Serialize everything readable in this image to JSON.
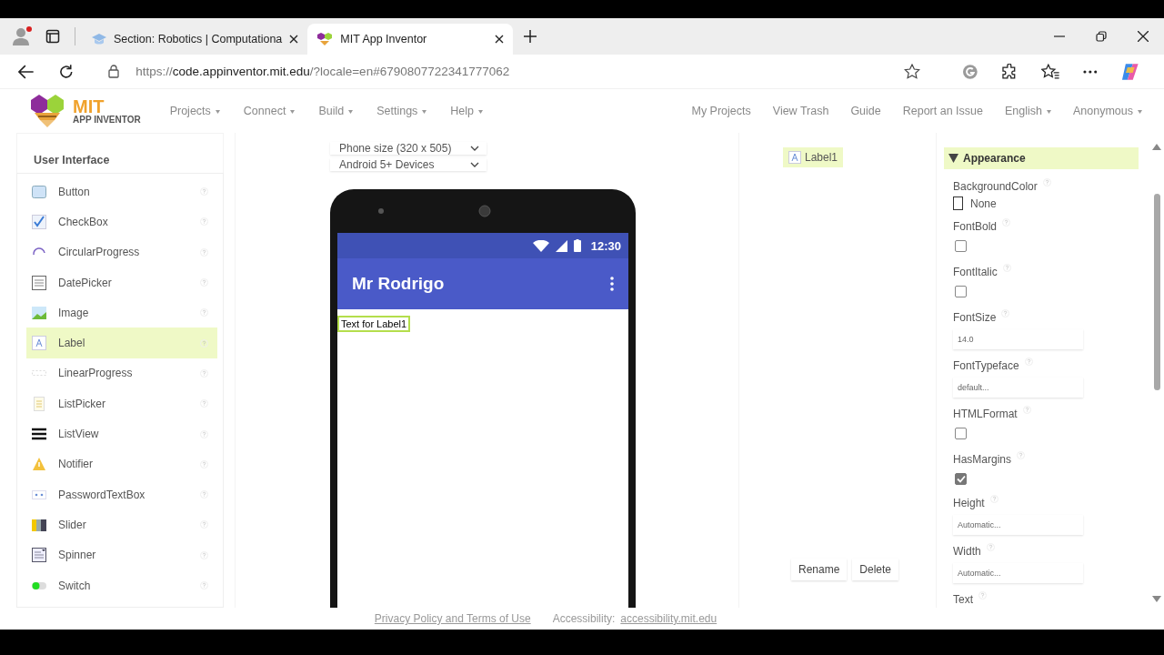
{
  "browser": {
    "tabs": [
      {
        "title": "Section: Robotics | Computationa",
        "selected": false
      },
      {
        "title": "MIT App Inventor",
        "selected": true
      }
    ],
    "url": {
      "scheme": "https://",
      "host": "code.appinventor.mit.edu",
      "path": "/?locale=en#6790807722341777062"
    }
  },
  "header": {
    "logo_title": "MIT",
    "logo_subtitle": "APP INVENTOR",
    "menus": [
      {
        "label": "Projects",
        "dropdown": true
      },
      {
        "label": "Connect",
        "dropdown": true
      },
      {
        "label": "Build",
        "dropdown": true
      },
      {
        "label": "Settings",
        "dropdown": true
      },
      {
        "label": "Help",
        "dropdown": true
      }
    ],
    "links": [
      {
        "label": "My Projects",
        "dropdown": false
      },
      {
        "label": "View Trash",
        "dropdown": false
      },
      {
        "label": "Guide",
        "dropdown": false
      },
      {
        "label": "Report an Issue",
        "dropdown": false
      },
      {
        "label": "English",
        "dropdown": true
      },
      {
        "label": "Anonymous",
        "dropdown": true
      }
    ]
  },
  "palette": {
    "title": "User Interface",
    "items": [
      {
        "name": "Button",
        "selected": false
      },
      {
        "name": "CheckBox",
        "selected": false
      },
      {
        "name": "CircularProgress",
        "selected": false
      },
      {
        "name": "DatePicker",
        "selected": false
      },
      {
        "name": "Image",
        "selected": false
      },
      {
        "name": "Label",
        "selected": true
      },
      {
        "name": "LinearProgress",
        "selected": false
      },
      {
        "name": "ListPicker",
        "selected": false
      },
      {
        "name": "ListView",
        "selected": false
      },
      {
        "name": "Notifier",
        "selected": false
      },
      {
        "name": "PasswordTextBox",
        "selected": false
      },
      {
        "name": "Slider",
        "selected": false
      },
      {
        "name": "Spinner",
        "selected": false
      },
      {
        "name": "Switch",
        "selected": false
      }
    ]
  },
  "viewer": {
    "screen_size": "Phone size (320 x 505)",
    "device": "Android 5+ Devices",
    "phone": {
      "time": "12:30",
      "app_title": "Mr Rodrigo",
      "label": {
        "text": "Text for Label1",
        "selected": true
      }
    }
  },
  "components": {
    "items": [
      {
        "name": "Label1",
        "selected": true
      }
    ],
    "buttons": [
      "Rename",
      "Delete"
    ]
  },
  "properties": {
    "section": {
      "title": "Appearance",
      "expanded": true
    },
    "items": [
      {
        "kind": "color",
        "name": "BackgroundColor",
        "value": "None"
      },
      {
        "kind": "checkbox",
        "name": "FontBold",
        "checked": false
      },
      {
        "kind": "checkbox",
        "name": "FontItalic",
        "checked": false
      },
      {
        "kind": "field",
        "name": "FontSize",
        "value": "14.0"
      },
      {
        "kind": "field",
        "name": "FontTypeface",
        "value": "default..."
      },
      {
        "kind": "checkbox",
        "name": "HTMLFormat",
        "checked": false
      },
      {
        "kind": "checkbox",
        "name": "HasMargins",
        "checked": true
      },
      {
        "kind": "field",
        "name": "Height",
        "value": "Automatic..."
      },
      {
        "kind": "field",
        "name": "Width",
        "value": "Automatic..."
      },
      {
        "kind": "label",
        "name": "Text"
      }
    ]
  },
  "footer": {
    "privacy": "Privacy Policy and Terms of Use",
    "accessibility_label": "Accessibility:",
    "accessibility_link": "accessibility.mit.edu"
  }
}
